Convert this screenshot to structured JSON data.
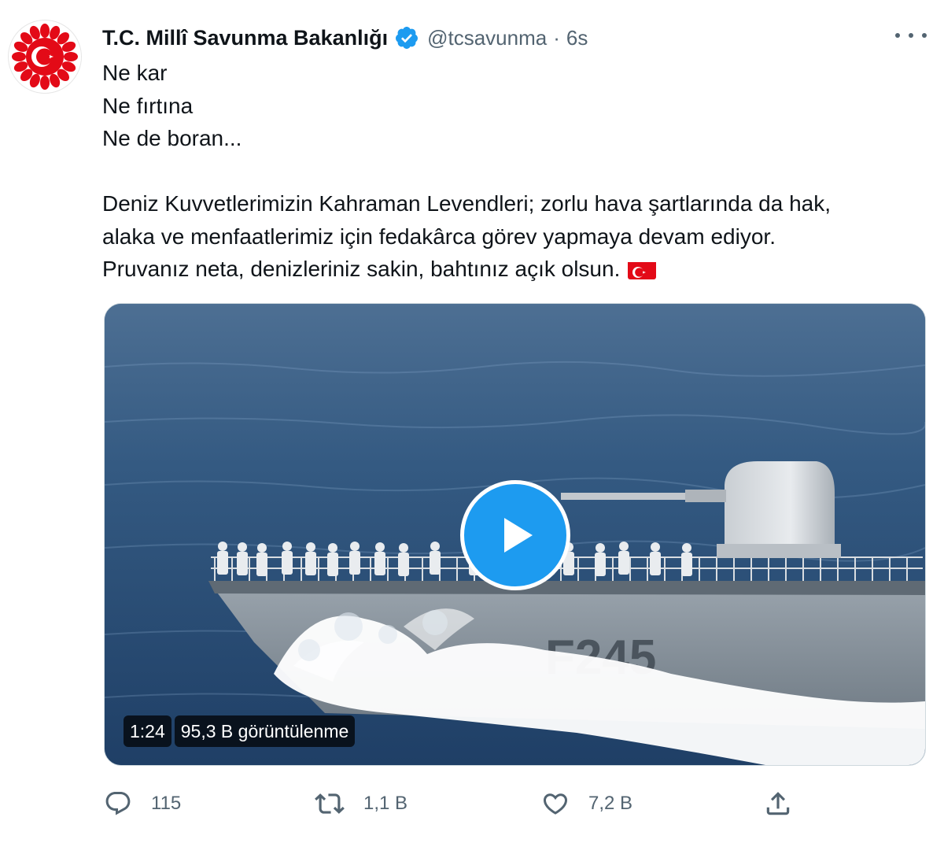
{
  "account": {
    "display_name": "T.C. Millî Savunma Bakanlığı",
    "handle": "@tcsavunma",
    "separator": "·",
    "time": "6s"
  },
  "tweet": {
    "lines": [
      "Ne kar",
      "Ne fırtına",
      "Ne de boran..."
    ],
    "paragraph": [
      "Deniz Kuvvetlerimizin Kahraman Levendleri; zorlu hava şartlarında da hak,",
      "alaka ve menfaatlerimiz için fedakârca görev yapmaya devam ediyor.",
      "Pruvanız neta, denizleriniz sakin, bahtınız açık olsun."
    ]
  },
  "video": {
    "duration": "1:24",
    "views": "95,3 B görüntülenme"
  },
  "actions": {
    "reply_count": "115",
    "retweet_count": "1,1 B",
    "like_count": "7,2 B"
  },
  "icons": {
    "avatar": "ministry-emblem-icon",
    "verified": "verified-badge-icon",
    "more": "more-options-icon",
    "play": "play-icon",
    "reply": "reply-icon",
    "retweet": "retweet-icon",
    "like": "heart-icon",
    "share": "share-icon",
    "flag": "turkey-flag-icon"
  },
  "colors": {
    "accent": "#1d9bf0",
    "emblem_red": "#e30a17",
    "muted_text": "#536471"
  }
}
